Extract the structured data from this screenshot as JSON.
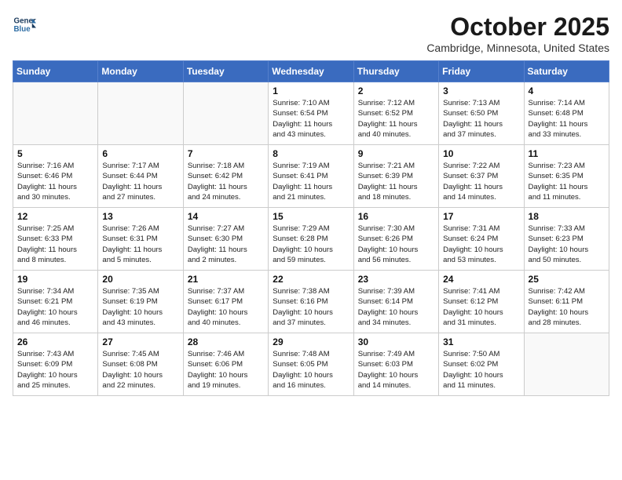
{
  "header": {
    "logo_line1": "General",
    "logo_line2": "Blue",
    "month": "October 2025",
    "location": "Cambridge, Minnesota, United States"
  },
  "weekdays": [
    "Sunday",
    "Monday",
    "Tuesday",
    "Wednesday",
    "Thursday",
    "Friday",
    "Saturday"
  ],
  "weeks": [
    [
      {
        "day": "",
        "info": ""
      },
      {
        "day": "",
        "info": ""
      },
      {
        "day": "",
        "info": ""
      },
      {
        "day": "1",
        "info": "Sunrise: 7:10 AM\nSunset: 6:54 PM\nDaylight: 11 hours\nand 43 minutes."
      },
      {
        "day": "2",
        "info": "Sunrise: 7:12 AM\nSunset: 6:52 PM\nDaylight: 11 hours\nand 40 minutes."
      },
      {
        "day": "3",
        "info": "Sunrise: 7:13 AM\nSunset: 6:50 PM\nDaylight: 11 hours\nand 37 minutes."
      },
      {
        "day": "4",
        "info": "Sunrise: 7:14 AM\nSunset: 6:48 PM\nDaylight: 11 hours\nand 33 minutes."
      }
    ],
    [
      {
        "day": "5",
        "info": "Sunrise: 7:16 AM\nSunset: 6:46 PM\nDaylight: 11 hours\nand 30 minutes."
      },
      {
        "day": "6",
        "info": "Sunrise: 7:17 AM\nSunset: 6:44 PM\nDaylight: 11 hours\nand 27 minutes."
      },
      {
        "day": "7",
        "info": "Sunrise: 7:18 AM\nSunset: 6:42 PM\nDaylight: 11 hours\nand 24 minutes."
      },
      {
        "day": "8",
        "info": "Sunrise: 7:19 AM\nSunset: 6:41 PM\nDaylight: 11 hours\nand 21 minutes."
      },
      {
        "day": "9",
        "info": "Sunrise: 7:21 AM\nSunset: 6:39 PM\nDaylight: 11 hours\nand 18 minutes."
      },
      {
        "day": "10",
        "info": "Sunrise: 7:22 AM\nSunset: 6:37 PM\nDaylight: 11 hours\nand 14 minutes."
      },
      {
        "day": "11",
        "info": "Sunrise: 7:23 AM\nSunset: 6:35 PM\nDaylight: 11 hours\nand 11 minutes."
      }
    ],
    [
      {
        "day": "12",
        "info": "Sunrise: 7:25 AM\nSunset: 6:33 PM\nDaylight: 11 hours\nand 8 minutes."
      },
      {
        "day": "13",
        "info": "Sunrise: 7:26 AM\nSunset: 6:31 PM\nDaylight: 11 hours\nand 5 minutes."
      },
      {
        "day": "14",
        "info": "Sunrise: 7:27 AM\nSunset: 6:30 PM\nDaylight: 11 hours\nand 2 minutes."
      },
      {
        "day": "15",
        "info": "Sunrise: 7:29 AM\nSunset: 6:28 PM\nDaylight: 10 hours\nand 59 minutes."
      },
      {
        "day": "16",
        "info": "Sunrise: 7:30 AM\nSunset: 6:26 PM\nDaylight: 10 hours\nand 56 minutes."
      },
      {
        "day": "17",
        "info": "Sunrise: 7:31 AM\nSunset: 6:24 PM\nDaylight: 10 hours\nand 53 minutes."
      },
      {
        "day": "18",
        "info": "Sunrise: 7:33 AM\nSunset: 6:23 PM\nDaylight: 10 hours\nand 50 minutes."
      }
    ],
    [
      {
        "day": "19",
        "info": "Sunrise: 7:34 AM\nSunset: 6:21 PM\nDaylight: 10 hours\nand 46 minutes."
      },
      {
        "day": "20",
        "info": "Sunrise: 7:35 AM\nSunset: 6:19 PM\nDaylight: 10 hours\nand 43 minutes."
      },
      {
        "day": "21",
        "info": "Sunrise: 7:37 AM\nSunset: 6:17 PM\nDaylight: 10 hours\nand 40 minutes."
      },
      {
        "day": "22",
        "info": "Sunrise: 7:38 AM\nSunset: 6:16 PM\nDaylight: 10 hours\nand 37 minutes."
      },
      {
        "day": "23",
        "info": "Sunrise: 7:39 AM\nSunset: 6:14 PM\nDaylight: 10 hours\nand 34 minutes."
      },
      {
        "day": "24",
        "info": "Sunrise: 7:41 AM\nSunset: 6:12 PM\nDaylight: 10 hours\nand 31 minutes."
      },
      {
        "day": "25",
        "info": "Sunrise: 7:42 AM\nSunset: 6:11 PM\nDaylight: 10 hours\nand 28 minutes."
      }
    ],
    [
      {
        "day": "26",
        "info": "Sunrise: 7:43 AM\nSunset: 6:09 PM\nDaylight: 10 hours\nand 25 minutes."
      },
      {
        "day": "27",
        "info": "Sunrise: 7:45 AM\nSunset: 6:08 PM\nDaylight: 10 hours\nand 22 minutes."
      },
      {
        "day": "28",
        "info": "Sunrise: 7:46 AM\nSunset: 6:06 PM\nDaylight: 10 hours\nand 19 minutes."
      },
      {
        "day": "29",
        "info": "Sunrise: 7:48 AM\nSunset: 6:05 PM\nDaylight: 10 hours\nand 16 minutes."
      },
      {
        "day": "30",
        "info": "Sunrise: 7:49 AM\nSunset: 6:03 PM\nDaylight: 10 hours\nand 14 minutes."
      },
      {
        "day": "31",
        "info": "Sunrise: 7:50 AM\nSunset: 6:02 PM\nDaylight: 10 hours\nand 11 minutes."
      },
      {
        "day": "",
        "info": ""
      }
    ]
  ]
}
